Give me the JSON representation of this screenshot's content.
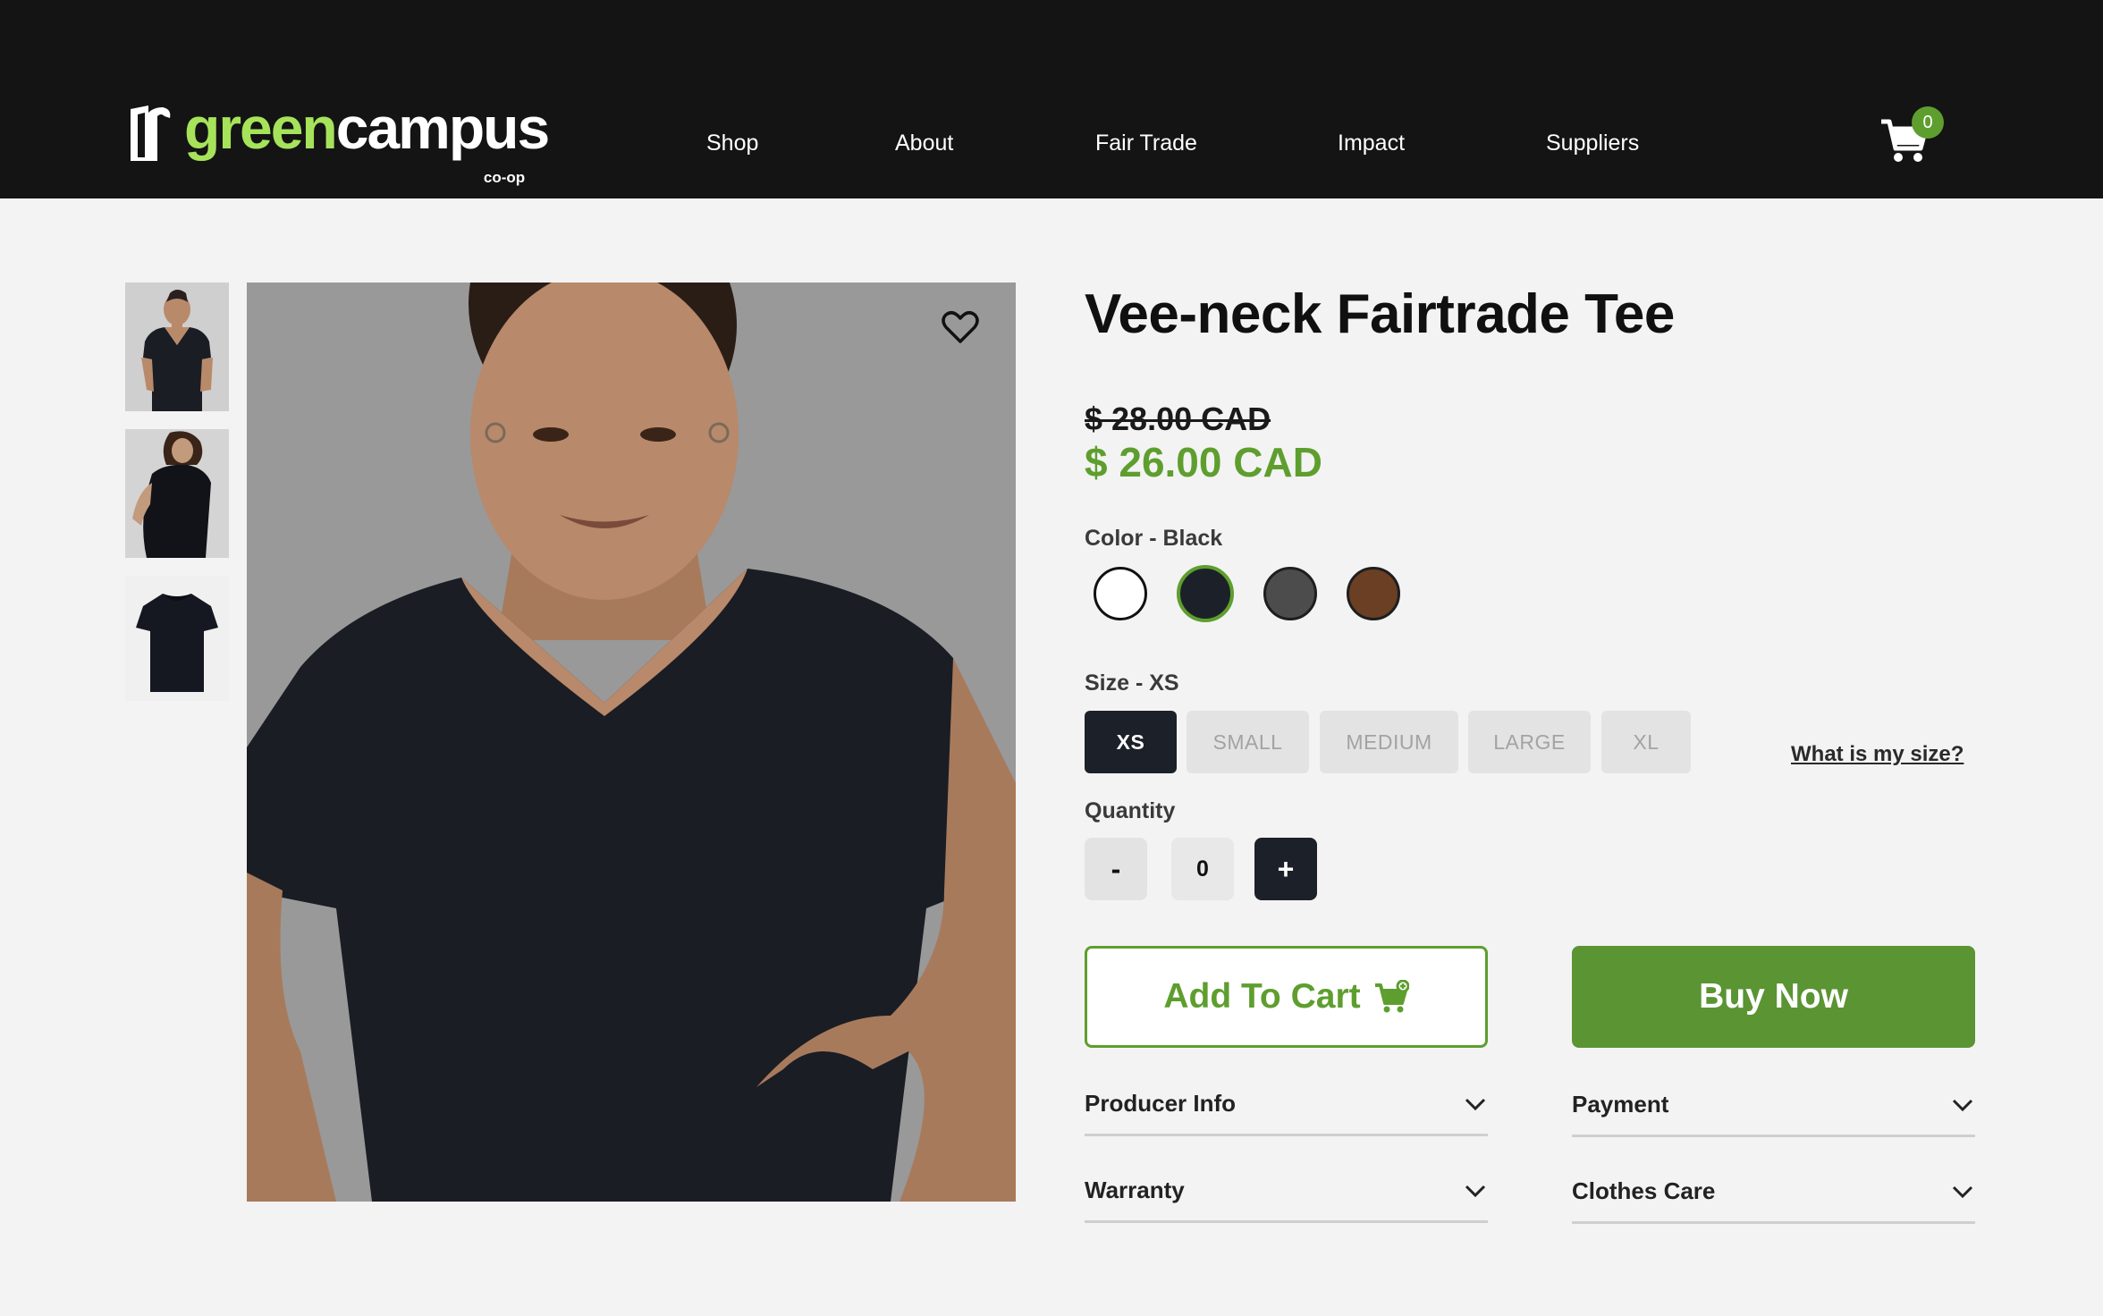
{
  "brand": {
    "name_green": "green",
    "name_white": "campus",
    "sub": "co-op"
  },
  "nav": {
    "items": [
      "Shop",
      "About",
      "Fair Trade",
      "Impact",
      "Suppliers"
    ]
  },
  "cart": {
    "count": "0"
  },
  "product": {
    "title": "Vee-neck Fairtrade Tee",
    "old_price": "$ 28.00 CAD",
    "new_price": "$ 26.00 CAD",
    "color_label": "Color - Black",
    "colors": [
      {
        "name": "White",
        "hex": "#ffffff"
      },
      {
        "name": "Black",
        "hex": "#1c2129"
      },
      {
        "name": "Grey",
        "hex": "#4c4c4c"
      },
      {
        "name": "Brown",
        "hex": "#6b3f23"
      }
    ],
    "selected_color": "Black",
    "size_label": "Size - XS",
    "sizes": [
      "XS",
      "SMALL",
      "MEDIUM",
      "LARGE",
      "XL"
    ],
    "selected_size": "XS",
    "size_help": "What is my size?",
    "quantity_label": "Quantity",
    "quantity": {
      "minus": "-",
      "value": "0",
      "plus": "+"
    },
    "add_to_cart": "Add To Cart",
    "buy_now": "Buy Now",
    "accordions": [
      "Producer Info",
      "Payment",
      "Warranty",
      "Clothes Care"
    ]
  },
  "colors": {
    "accent": "#5e9e2e",
    "logo_green": "#a6e35a",
    "header_bg": "#141414",
    "dark": "#1c2129"
  }
}
